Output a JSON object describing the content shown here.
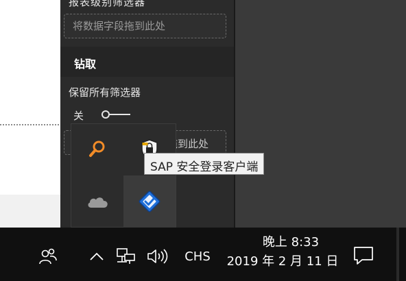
{
  "filters_pane": {
    "report_filters_title": "报表级别筛选器",
    "drop_zone_placeholder": "将数据字段拖到此处",
    "drill_title": "钻取",
    "keep_all_filters_label": "保留所有筛选器",
    "toggle_state": "关",
    "drop_zone_2_partial": "拖到此处"
  },
  "tray_flyout": {
    "icons": [
      {
        "name": "search-icon",
        "color": "#f28c28"
      },
      {
        "name": "sap-secure-login-icon"
      },
      {
        "name": "onedrive-cloud-icon",
        "color": "#9a9a9a"
      },
      {
        "name": "checkmark-app-icon",
        "color": "#1e6fd9"
      }
    ],
    "tooltip": "SAP 安全登录客户端"
  },
  "taskbar": {
    "ime_label": "CHS",
    "time": "晚上 8:33",
    "date": "2019 年 2 月 11 日"
  }
}
